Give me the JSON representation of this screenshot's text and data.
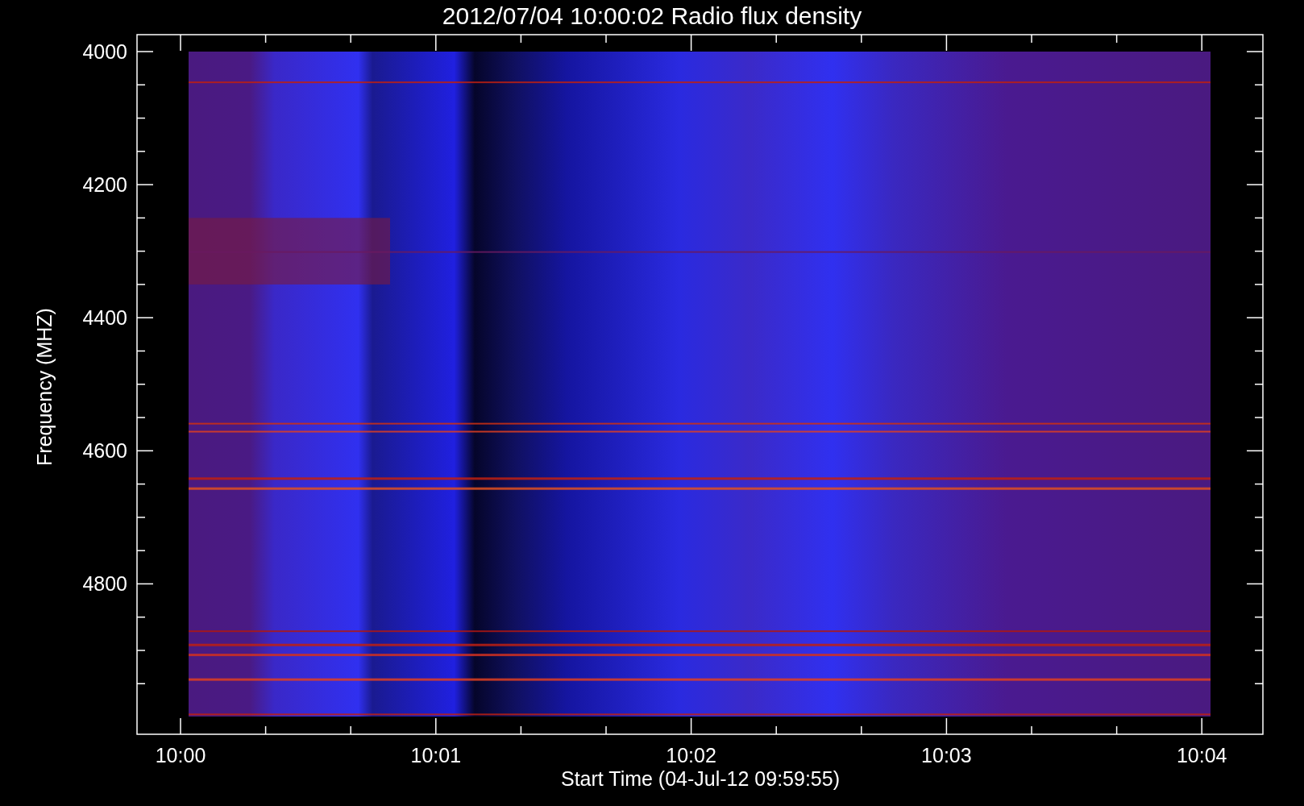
{
  "plot": {
    "title": "2012/07/04 10:00:02 Radio flux density",
    "xlabel": "Start Time (04-Jul-12 09:59:55)",
    "ylabel": "Frequency (MHZ)",
    "yticks": [
      "4000",
      "4200",
      "4400",
      "4600",
      "4800"
    ],
    "xticks": [
      "10:00",
      "10:01",
      "10:02",
      "10:03",
      "10:04"
    ]
  }
}
